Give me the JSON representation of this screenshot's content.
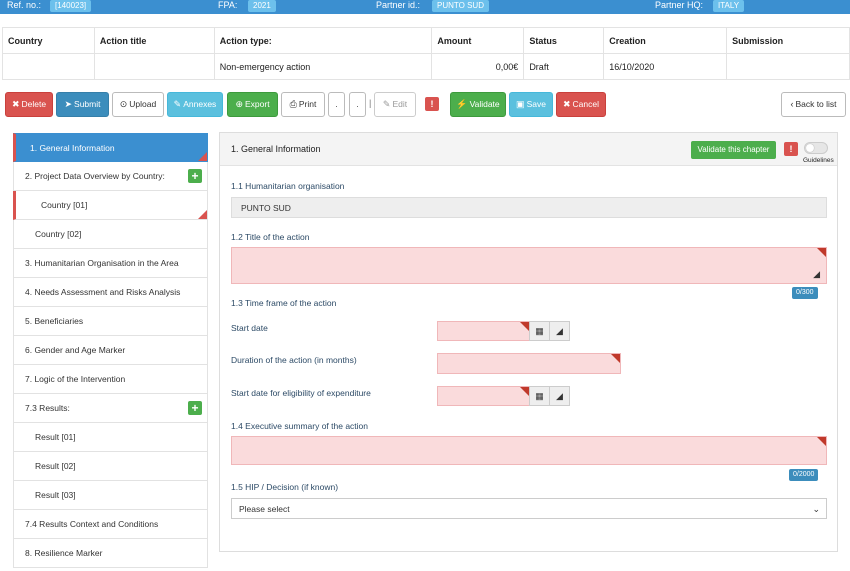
{
  "topbar": {
    "ref_label": "Ref. no.:",
    "ref_value": "[140023]",
    "fpa_label": "FPA:",
    "fpa_value": "2021",
    "partner_id_label": "Partner id.:",
    "partner_id_value": "PUNTO SUD",
    "partner_hq_label": "Partner HQ:",
    "partner_hq_value": "ITALY"
  },
  "summary": {
    "columns": [
      "Country",
      "Action title",
      "Action type:",
      "Amount",
      "Status",
      "Creation",
      "Submission"
    ],
    "row": [
      "",
      "",
      "Non-emergency action",
      "0,00€",
      "Draft",
      "16/10/2020",
      ""
    ]
  },
  "toolbar": {
    "delete": "Delete",
    "submit": "Submit",
    "upload": "Upload",
    "annexes": "Annexes",
    "export": "Export",
    "print": "Print",
    "dot1": ".",
    "dot2": ".",
    "separator": "|",
    "edit": "Edit",
    "warning": "!",
    "validate": "Validate",
    "save": "Save",
    "cancel": "Cancel",
    "back": "Back to list"
  },
  "sidebar": {
    "items": [
      {
        "label": "1. General Information"
      },
      {
        "label": "2. Project Data Overview by Country:"
      },
      {
        "label": "Country [01]"
      },
      {
        "label": "Country [02]"
      },
      {
        "label": "3. Humanitarian Organisation in the Area"
      },
      {
        "label": "4. Needs Assessment and Risks Analysis"
      },
      {
        "label": "5. Beneficiaries"
      },
      {
        "label": "6. Gender and Age Marker"
      },
      {
        "label": "7. Logic of the Intervention"
      },
      {
        "label": "7.3 Results:"
      },
      {
        "label": "Result [01]"
      },
      {
        "label": "Result [02]"
      },
      {
        "label": "Result [03]"
      },
      {
        "label": "7.4 Results Context and Conditions"
      },
      {
        "label": "8. Resilience Marker"
      }
    ],
    "plus": "+"
  },
  "panel": {
    "title": "1. General Information",
    "validate_chapter": "Validate this chapter",
    "warning": "!",
    "guidelines": "Guidelines",
    "s11": "1.1 Humanitarian organisation",
    "org_value": "PUNTO SUD",
    "s12": "1.2 Title of the action",
    "title_counter": "0/300",
    "s13": "1.3 Time frame of the action",
    "start_date": "Start date",
    "duration": "Duration of the action (in months)",
    "eligibility": "Start date for eligibility of expenditure",
    "s14": "1.4 Executive summary of the action",
    "summary_counter": "0/2000",
    "s15": "1.5 HIP / Decision (if known)",
    "hip_placeholder": "Please select"
  },
  "colors": {
    "primary": "#3b8fd0",
    "danger": "#d9534f",
    "success": "#4cae4c",
    "info": "#5bc0de",
    "required_field": "#fadbdc"
  }
}
